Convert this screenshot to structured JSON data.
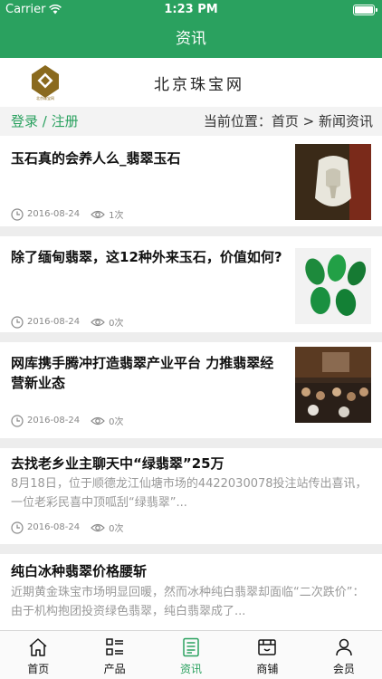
{
  "status_bar": {
    "carrier": "Carrier",
    "time": "1:23 PM"
  },
  "nav": {
    "title": "资讯"
  },
  "brand": {
    "site_name": "北京珠宝网",
    "logo_text": "北京珠宝网"
  },
  "location": {
    "login": "登录 / 注册",
    "breadcrumb": "当前位置：首页 > 新闻资讯"
  },
  "articles": [
    {
      "title": "玉石真的会养人么_翡翠玉石",
      "date": "2016-08-24",
      "views": "1次"
    },
    {
      "title": "除了缅甸翡翠，这12种外来玉石，价值如何?",
      "date": "2016-08-24",
      "views": "0次"
    },
    {
      "title": "网库携手腾冲打造翡翠产业平台 力推翡翠经营新业态",
      "date": "2016-08-24",
      "views": "0次"
    },
    {
      "title": "去找老乡业主聊天中“绿翡翠”25万",
      "summary": "8月18日，位于顺德龙江仙塘市场的4422030078投注站传出喜讯，一位老彩民喜中顶呱刮“绿翡翠”...",
      "date": "2016-08-24",
      "views": "0次"
    },
    {
      "title": "纯白冰种翡翠价格腰斩",
      "summary": "近期黄金珠宝市场明显回暖，然而冰种纯白翡翠却面临“二次跌价”：由于机构抱团投资绿色翡翠，纯白翡翠成了..."
    }
  ],
  "tabs": [
    {
      "label": "首页",
      "icon": "home-icon"
    },
    {
      "label": "产品",
      "icon": "grid-list-icon"
    },
    {
      "label": "资讯",
      "icon": "news-icon"
    },
    {
      "label": "商铺",
      "icon": "shop-icon"
    },
    {
      "label": "会员",
      "icon": "person-icon"
    }
  ],
  "colors": {
    "brand_green": "#2aa15f",
    "logo_gold": "#8a6a1e"
  }
}
